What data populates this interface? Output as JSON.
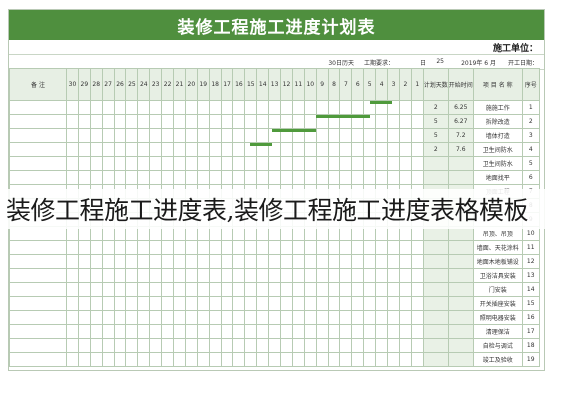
{
  "sheet": {
    "title": "装修工程施工进度计划表",
    "unit_label": "施工单位：",
    "info": [
      "开工日期：",
      "2019年 6 月",
      "25",
      "日",
      "工期要求：",
      "30日历天"
    ],
    "day_headers": [
      "1",
      "2",
      "3",
      "4",
      "5",
      "6",
      "7",
      "8",
      "9",
      "10",
      "11",
      "12",
      "13",
      "14",
      "15",
      "16",
      "17",
      "18",
      "19",
      "20",
      "21",
      "22",
      "23",
      "24",
      "25",
      "26",
      "27",
      "28",
      "29",
      "30"
    ],
    "col_headers": {
      "remark": "备 注",
      "plan_days": "计划天数",
      "start_date": "开始时间",
      "project": "项 目 名 称",
      "seq": "序号"
    },
    "rows": [
      {
        "seq": "1",
        "name": "施施工作",
        "days": "2",
        "start": "6.25",
        "bar_start": 1,
        "bar_len": 2
      },
      {
        "seq": "2",
        "name": "拆除改造",
        "days": "5",
        "start": "6.27",
        "bar_start": 3,
        "bar_len": 5
      },
      {
        "seq": "3",
        "name": "墙体打造",
        "days": "5",
        "start": "7.2",
        "bar_start": 8,
        "bar_len": 4
      },
      {
        "seq": "4",
        "name": "卫生间防水",
        "days": "2",
        "start": "7.6",
        "bar_start": 12,
        "bar_len": 2
      },
      {
        "seq": "5",
        "name": "卫生间防水",
        "days": "",
        "start": "",
        "bar_start": 0,
        "bar_len": 0
      },
      {
        "seq": "6",
        "name": "地面找平",
        "days": "",
        "start": "",
        "bar_start": 0,
        "bar_len": 0
      },
      {
        "seq": "7",
        "name": "顶面工程",
        "days": "",
        "start": "",
        "bar_start": 0,
        "bar_len": 0
      },
      {
        "seq": "8",
        "name": "",
        "days": "",
        "start": "",
        "bar_start": 0,
        "bar_len": 0
      },
      {
        "seq": "9",
        "name": "",
        "days": "",
        "start": "",
        "bar_start": 0,
        "bar_len": 0
      },
      {
        "seq": "10",
        "name": "吊顶、吊顶",
        "days": "",
        "start": "",
        "bar_start": 0,
        "bar_len": 0
      },
      {
        "seq": "11",
        "name": "墙面、天花涂料",
        "days": "",
        "start": "",
        "bar_start": 0,
        "bar_len": 0
      },
      {
        "seq": "12",
        "name": "地面木地板铺设",
        "days": "",
        "start": "",
        "bar_start": 0,
        "bar_len": 0
      },
      {
        "seq": "13",
        "name": "卫浴洁具安装",
        "days": "",
        "start": "",
        "bar_start": 0,
        "bar_len": 0
      },
      {
        "seq": "14",
        "name": "门安装",
        "days": "",
        "start": "",
        "bar_start": 0,
        "bar_len": 0
      },
      {
        "seq": "15",
        "name": "开关插座安装",
        "days": "",
        "start": "",
        "bar_start": 0,
        "bar_len": 0
      },
      {
        "seq": "16",
        "name": "照明电器安装",
        "days": "",
        "start": "",
        "bar_start": 0,
        "bar_len": 0
      },
      {
        "seq": "17",
        "name": "清理保洁",
        "days": "",
        "start": "",
        "bar_start": 0,
        "bar_len": 0
      },
      {
        "seq": "18",
        "name": "自检与调试",
        "days": "",
        "start": "",
        "bar_start": 0,
        "bar_len": 0
      },
      {
        "seq": "19",
        "name": "竣工及验收",
        "days": "",
        "start": "",
        "bar_start": 0,
        "bar_len": 0
      }
    ]
  },
  "overlay_caption": "装修工程施工进度表,装修工程施工进度表格模板",
  "colors": {
    "accent": "#4f8f3e",
    "bar": "#4f9a3c",
    "grid": "#b7cbb3"
  }
}
